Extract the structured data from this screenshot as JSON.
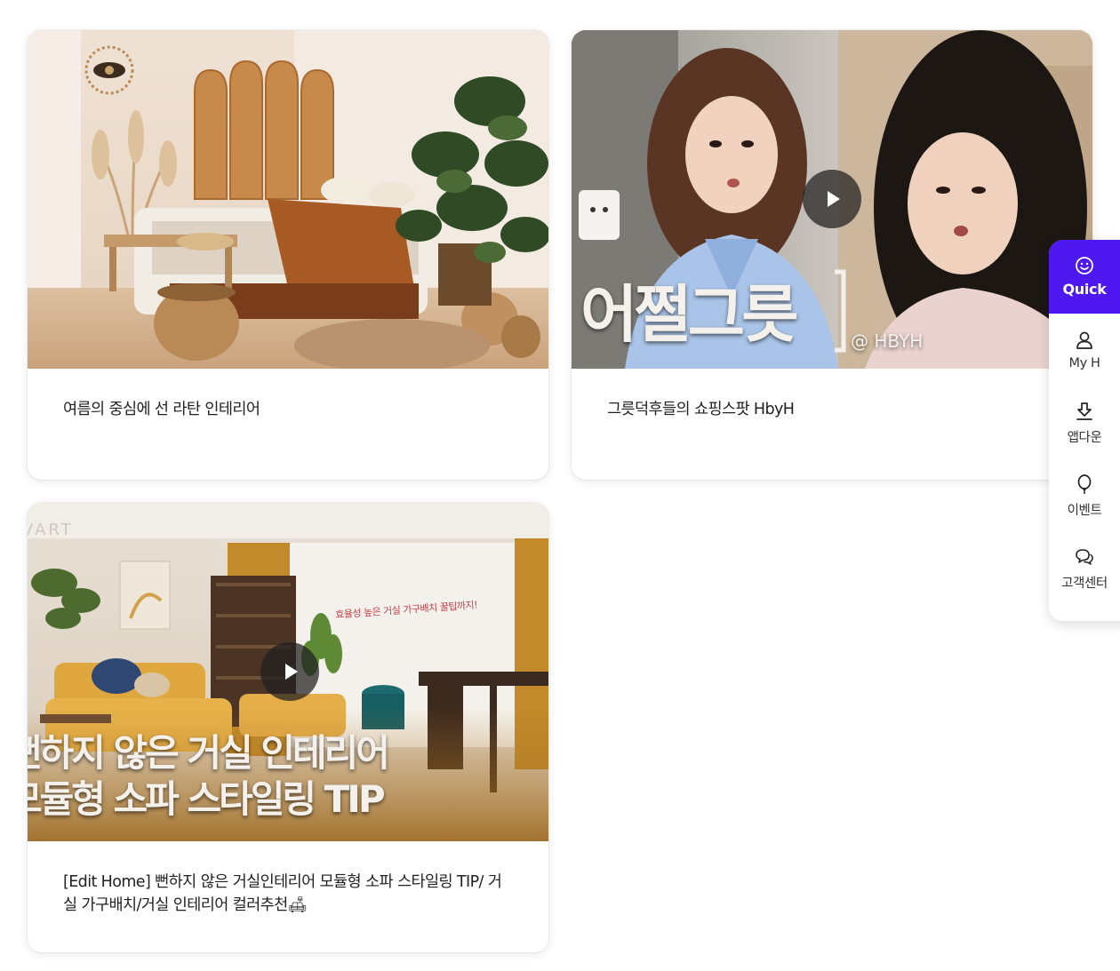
{
  "cards": [
    {
      "title": "여름의 중심에 선 라탄 인테리어",
      "has_video": false
    },
    {
      "title": "그릇덕후들의 쇼핑스팟 HbyH",
      "has_video": true,
      "overlay_headline": "어쩔그릇",
      "overlay_handle": "@ HBYH"
    },
    {
      "title": "[Edit Home] 뻔하지 않은 거실인테리어 모듈형 소파 스타일링 TIP/ 거실 가구배치/거실 인테리어 컬러추천🛋",
      "has_video": true,
      "overlay_brand": "VART",
      "overlay_line1": "뻔하지 않은 거실 인테리어",
      "overlay_line2": "모듈형 소파 스타일링 TIP",
      "overlay_sub": "효율성 높은 거실 가구배치 꿀팁까지!"
    }
  ],
  "quick_menu": {
    "header": {
      "label": "Quick",
      "icon": "smile-icon"
    },
    "items": [
      {
        "label": "My H",
        "icon": "user-icon"
      },
      {
        "label": "앱다운",
        "icon": "download-icon"
      },
      {
        "label": "이벤트",
        "icon": "balloon-icon"
      },
      {
        "label": "고객센터",
        "icon": "chat-bubbles-icon"
      }
    ]
  },
  "colors": {
    "quick_accent": "#4e18f0",
    "card_text": "#222222"
  }
}
